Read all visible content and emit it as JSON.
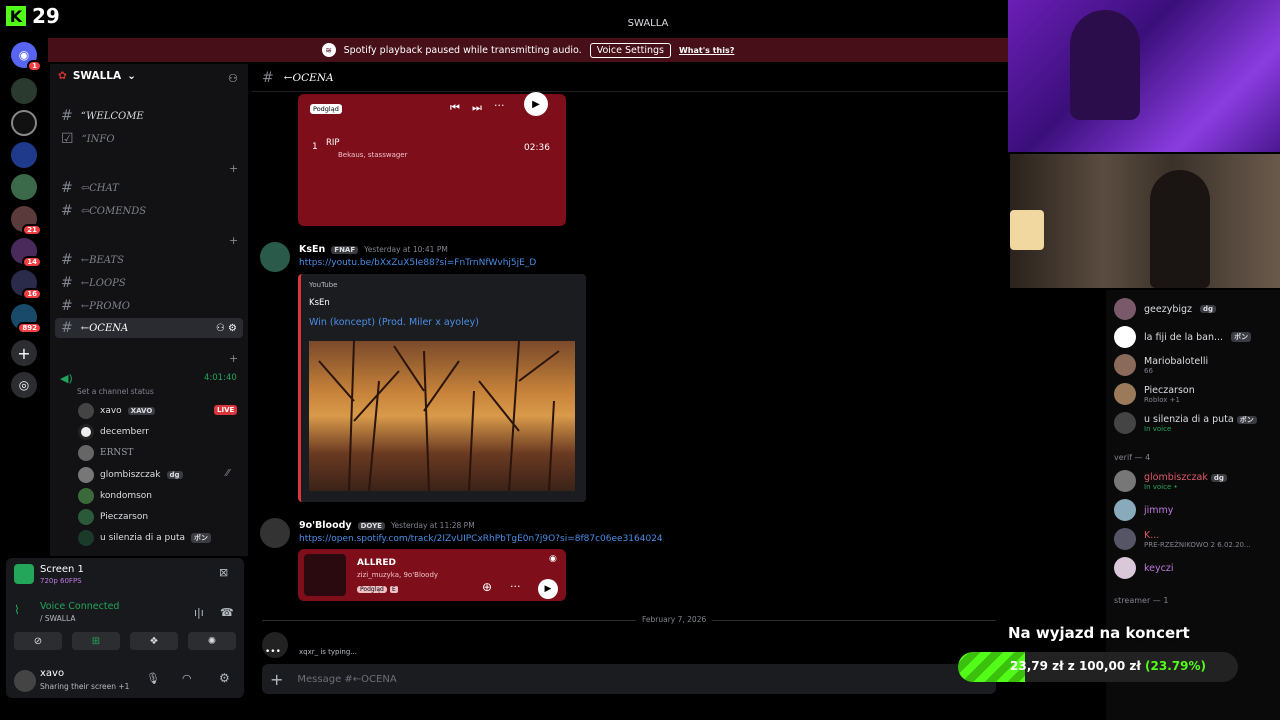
{
  "kick": {
    "logo": "K",
    "viewer_count": "29"
  },
  "rail_badges": [
    "1",
    "21",
    "14",
    "16",
    "892"
  ],
  "window_title": "SWALLA",
  "notice": {
    "text": "Spotify playback paused while transmitting audio.",
    "button": "Voice Settings",
    "link": "What's this?"
  },
  "server": {
    "name": "SWALLA"
  },
  "channels": [
    {
      "name": "“WELCOME"
    },
    {
      "name": "“INFO"
    },
    {
      "name": "⇦CHAT"
    },
    {
      "name": "⇦COMENDS"
    },
    {
      "name": "←BEATS"
    },
    {
      "name": "←LOOPS"
    },
    {
      "name": "←PROMO"
    },
    {
      "name": "←OCENA"
    }
  ],
  "voice": {
    "timer": "4:01:40",
    "status_prompt": "Set a channel status",
    "users": [
      {
        "name": "xavo",
        "tag": "XAVO",
        "live": "LIVE"
      },
      {
        "name": "decemberr"
      },
      {
        "name": "ERNST"
      },
      {
        "name": "glombiszczak",
        "tag": "dg"
      },
      {
        "name": "kondomson"
      },
      {
        "name": "Pieczarson"
      },
      {
        "name": "u silenzia di a puta",
        "tag": "ポン"
      }
    ]
  },
  "screen_share": {
    "title": "Screen 1",
    "quality": "720p 60FPS"
  },
  "voice_connected": {
    "label": "Voice Connected",
    "channel": "/ SWALLA"
  },
  "user_panel": {
    "name": "xavo",
    "status": "Sharing their screen +1"
  },
  "chat": {
    "channel": "←OCENA",
    "spotify_top": {
      "badge": "Podgląd",
      "track_no": "1",
      "track": "RIP",
      "artists": "Bekaus, stasswager",
      "duration": "02:36"
    },
    "msg1": {
      "author": "KsEn",
      "tag": "FNAF",
      "time": "Yesterday at 10:41 PM",
      "link": "https://youtu.be/bXxZuX5Ie88?si=FnTrnNfWvhj5jE_D",
      "provider": "YouTube",
      "channel": "KsEn",
      "title": "Win (koncept) (Prod. Miler x ayoley)"
    },
    "msg2": {
      "author": "9o'Bloody",
      "tag": "DOYE",
      "time": "Yesterday at 11:28 PM",
      "link": "https://open.spotify.com/track/2IZvUIPCxRhPbTgE0n7j9O?si=8f87c06ee3164024",
      "track": "ALLRED",
      "artists": "zizi_muzyka, 9o'Bloody",
      "badge": "Podgląd",
      "explicit": "E"
    },
    "date_divider": "February 7, 2026",
    "typing": "xqxr_ is typing...",
    "composer_placeholder": "Message #←OCENA"
  },
  "members": {
    "online": [
      {
        "name": "geezybigz",
        "tag": "dg"
      },
      {
        "name": "la fiji de la ban...",
        "tag": "ポン"
      },
      {
        "name": "Mariobalotelli",
        "sub": "66"
      },
      {
        "name": "Pieczarson",
        "sub": "Roblox +1"
      },
      {
        "name": "u silenzia di a puta",
        "tag": "ポン",
        "sub": "In voice"
      }
    ],
    "verif_header": "verif — 4",
    "verif": [
      {
        "name": "glombiszczak",
        "tag": "dg",
        "sub": "In voice •"
      },
      {
        "name": "jimmy"
      },
      {
        "name": "K...",
        "sub": "PRE-RZEŻNIKOWO 2 6.02.20..."
      },
      {
        "name": "keyczi"
      }
    ],
    "streamer_header": "streamer — 1"
  },
  "goal": {
    "title": "Na wyjazd na koncert",
    "current": "23,79 zł",
    "sep": "z",
    "target": "100,00 zł",
    "percent_label": "(23.79%)",
    "percent": 23.79
  },
  "colors": {
    "accent_red": "#7e0e1a",
    "kick_green": "#53fc18",
    "link": "#4b8ee6"
  }
}
